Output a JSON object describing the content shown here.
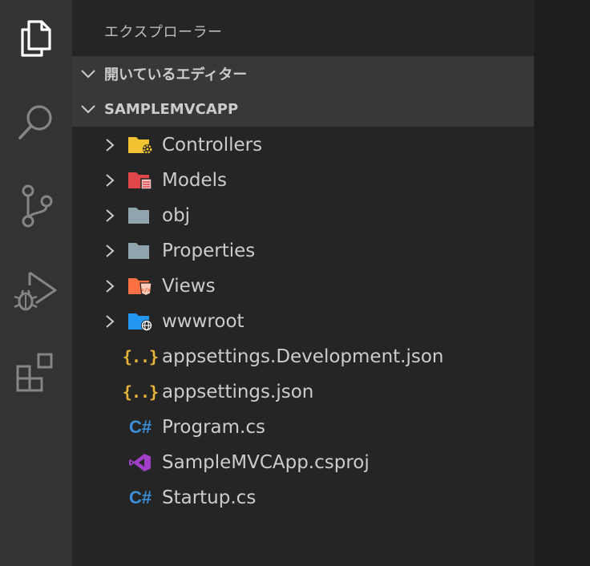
{
  "activity_bar": {
    "items": [
      {
        "icon": "files-icon",
        "active": true
      },
      {
        "icon": "search-icon",
        "active": false
      },
      {
        "icon": "source-control-icon",
        "active": false
      },
      {
        "icon": "run-debug-icon",
        "active": false
      },
      {
        "icon": "extensions-icon",
        "active": false
      }
    ]
  },
  "sidebar": {
    "title": "エクスプローラー",
    "sections": [
      {
        "label": "開いているエディター",
        "expanded": false
      },
      {
        "label": "SAMPLEMVCAPP",
        "expanded": true
      }
    ]
  },
  "tree": {
    "items": [
      {
        "name": "Controllers",
        "kind": "folder",
        "icon": "folder-controllers-icon",
        "color": "#f1c232"
      },
      {
        "name": "Models",
        "kind": "folder",
        "icon": "folder-models-icon",
        "color": "#e0474b"
      },
      {
        "name": "obj",
        "kind": "folder",
        "icon": "folder-icon",
        "color": "#90a4ae"
      },
      {
        "name": "Properties",
        "kind": "folder",
        "icon": "folder-icon",
        "color": "#90a4ae"
      },
      {
        "name": "Views",
        "kind": "folder",
        "icon": "folder-views-icon",
        "color": "#ff7043"
      },
      {
        "name": "wwwroot",
        "kind": "folder",
        "icon": "folder-www-icon",
        "color": "#2196f3"
      },
      {
        "name": "appsettings.Development.json",
        "kind": "file",
        "icon": "json-icon",
        "glyph": "{..}"
      },
      {
        "name": "appsettings.json",
        "kind": "file",
        "icon": "json-icon",
        "glyph": "{..}"
      },
      {
        "name": "Program.cs",
        "kind": "file",
        "icon": "csharp-icon",
        "glyph": "C#"
      },
      {
        "name": "SampleMVCApp.csproj",
        "kind": "file",
        "icon": "visual-studio-icon"
      },
      {
        "name": "Startup.cs",
        "kind": "file",
        "icon": "csharp-icon",
        "glyph": "C#"
      }
    ]
  },
  "colors": {
    "activity_bar_bg": "#333333",
    "sidebar_bg": "#252526",
    "section_header_bg": "#383838",
    "text": "#cccccc",
    "json_icon": "#e8b53a",
    "csharp_icon": "#3b8fd9",
    "vs_icon": "#a040c8"
  }
}
